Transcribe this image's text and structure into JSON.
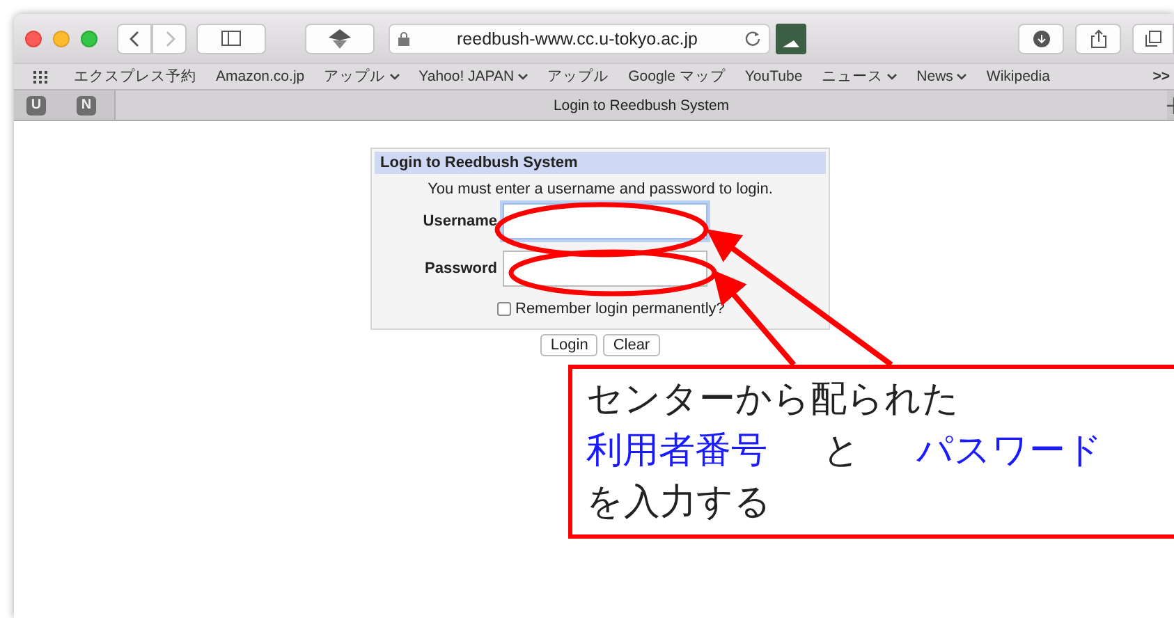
{
  "browser": {
    "address": "reedbush-www.cc.u-tokyo.ac.jp",
    "bookmarks": [
      {
        "label": "エクスプレス予約",
        "menu": false
      },
      {
        "label": "Amazon.co.jp",
        "menu": false
      },
      {
        "label": "アップル",
        "menu": true
      },
      {
        "label": "Yahoo! JAPAN",
        "menu": true
      },
      {
        "label": "アップル",
        "menu": false
      },
      {
        "label": "Google マップ",
        "menu": false
      },
      {
        "label": "YouTube",
        "menu": false
      },
      {
        "label": "ニュース",
        "menu": true
      },
      {
        "label": "News",
        "menu": true
      },
      {
        "label": "Wikipedia",
        "menu": false
      }
    ],
    "overflow": ">>",
    "pinned_tabs": [
      "U",
      "N"
    ],
    "tab_title": "Login to Reedbush System"
  },
  "login": {
    "title": "Login to Reedbush System",
    "message": "You must enter a username and password to login.",
    "fields": [
      {
        "label": "Username",
        "focused": true
      },
      {
        "label": "Password",
        "focused": false
      }
    ],
    "remember": {
      "label": "Remember login permanently?",
      "checked": false
    },
    "buttons": [
      "Login",
      "Clear"
    ]
  },
  "callout": {
    "lines": [
      [
        {
          "text": "センターから配られた",
          "highlighted": false
        }
      ],
      [
        {
          "text": "利用者番号",
          "highlighted": true
        },
        {
          "text": "と",
          "highlighted": false
        },
        {
          "text": "パスワード",
          "highlighted": true
        }
      ],
      [
        {
          "text": "を入力する",
          "highlighted": false
        }
      ]
    ]
  }
}
